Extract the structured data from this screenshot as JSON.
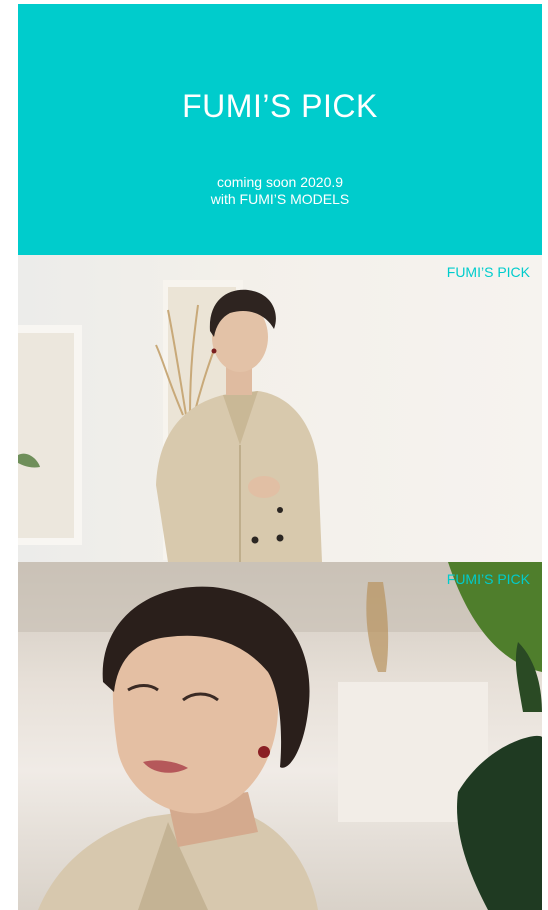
{
  "hero": {
    "title": "FUMI’S PICK",
    "line1": "coming soon 2020.9",
    "line2": "with FUMI’S MODELS",
    "bg_color": "#00CCCC"
  },
  "photos": [
    {
      "tag": "FUMI’S PICK"
    },
    {
      "tag": "FUMI’S PICK"
    }
  ]
}
